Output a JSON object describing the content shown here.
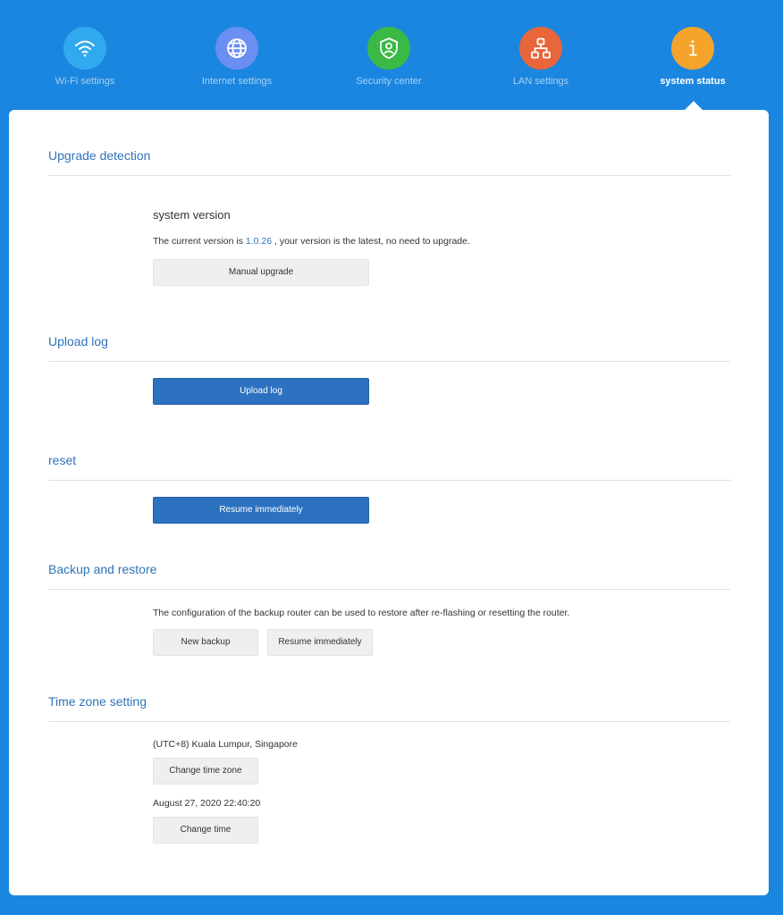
{
  "nav": {
    "items": [
      {
        "label": "Wi-Fi settings",
        "icon": "wifi-icon",
        "color": "#31a9ee"
      },
      {
        "label": "Internet settings",
        "icon": "globe-icon",
        "color": "#6b8ef2"
      },
      {
        "label": "Security center",
        "icon": "shield-user-icon",
        "color": "#3bb946"
      },
      {
        "label": "LAN settings",
        "icon": "network-icon",
        "color": "#e8663a"
      },
      {
        "label": "system status",
        "icon": "info-icon",
        "color": "#f5a42b"
      }
    ],
    "active": "system status"
  },
  "upgrade": {
    "title": "Upgrade detection",
    "subtitle": "system version",
    "text_before": "The current version is ",
    "version": "1.0.26",
    "text_after": " , your version is the latest, no need to upgrade.",
    "button": "Manual upgrade"
  },
  "upload_log": {
    "title": "Upload log",
    "button": "Upload log"
  },
  "reset": {
    "title": "reset",
    "button": "Resume immediately"
  },
  "backup": {
    "title": "Backup and restore",
    "description": "The configuration of the backup router can be used to restore after re-flashing or resetting the router.",
    "backup_button": "New backup",
    "restore_button": "Resume immediately"
  },
  "timezone": {
    "title": "Time zone setting",
    "zone": "(UTC+8) Kuala Lumpur, Singapore",
    "zone_button": "Change time zone",
    "datetime": "August 27, 2020 22:40:20",
    "time_button": "Change time"
  },
  "colors": {
    "background": "#1a86e0",
    "accent": "#2f73b8",
    "primary_button": "#2c72c0"
  }
}
